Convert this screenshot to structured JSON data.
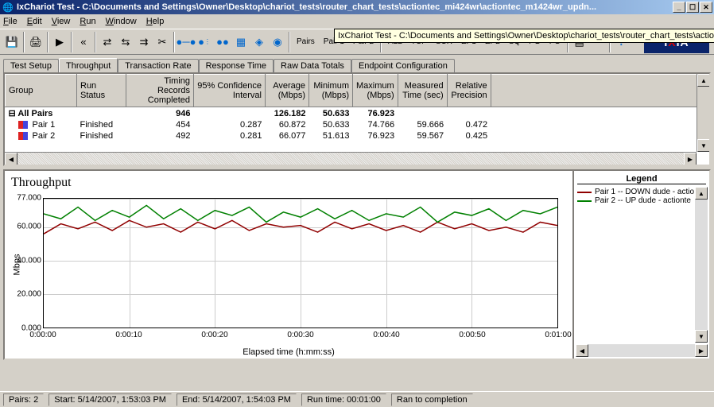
{
  "window": {
    "title": "IxChariot Test - C:\\Documents and Settings\\Owner\\Desktop\\chariot_tests\\router_chart_tests\\actiontec_mi424wr\\actiontec_m1424wr_updn..."
  },
  "tooltip": "IxChariot Test - C:\\Documents and Settings\\Owner\\Desktop\\chariot_tests\\router_chart_tests\\actio",
  "menu": {
    "file": "File",
    "edit": "Edit",
    "view": "View",
    "run": "Run",
    "window": "Window",
    "help": "Help"
  },
  "toolbar_text_btns": {
    "pairs": "Pairs",
    "pair1": "Pair 1",
    "pair2": "Pair 2",
    "all": "ALL",
    "tcp": "TCP",
    "scr": "SCR",
    "ep1": "EP1",
    "ep2": "EP2",
    "sq": "SQ",
    "pg": "PG",
    "pc": "PC"
  },
  "logo": {
    "i": "I",
    "x": "X",
    "ia": "IA"
  },
  "tabs": {
    "test_setup": "Test Setup",
    "throughput": "Throughput",
    "transaction_rate": "Transaction Rate",
    "response_time": "Response Time",
    "raw_data_totals": "Raw Data Totals",
    "endpoint_config": "Endpoint Configuration"
  },
  "grid": {
    "headers": {
      "group": "Group",
      "run_status": "Run Status",
      "timing": "Timing Records Completed",
      "conf": "95% Confidence Interval",
      "avg": "Average (Mbps)",
      "min": "Minimum (Mbps)",
      "max": "Maximum (Mbps)",
      "meas": "Measured Time (sec)",
      "prec": "Relative Precision"
    },
    "summary": {
      "group": "All Pairs",
      "timing": "946",
      "avg": "126.182",
      "min": "50.633",
      "max": "76.923"
    },
    "rows": [
      {
        "group": "Pair 1",
        "status": "Finished",
        "timing": "454",
        "conf": "0.287",
        "avg": "60.872",
        "min": "50.633",
        "max": "74.766",
        "meas": "59.666",
        "prec": "0.472"
      },
      {
        "group": "Pair 2",
        "status": "Finished",
        "timing": "492",
        "conf": "0.281",
        "avg": "66.077",
        "min": "51.613",
        "max": "76.923",
        "meas": "59.567",
        "prec": "0.425"
      }
    ]
  },
  "chart_data": {
    "type": "line",
    "title": "Throughput",
    "ylabel": "Mbps",
    "xlabel": "Elapsed time (h:mm:ss)",
    "ylim": [
      0,
      77
    ],
    "yticks": [
      "0.000",
      "20.000",
      "40.000",
      "60.000",
      "77.000"
    ],
    "ytick_vals": [
      0,
      20,
      40,
      60,
      77
    ],
    "xticks": [
      "0:00:00",
      "0:00:10",
      "0:00:20",
      "0:00:30",
      "0:00:40",
      "0:00:50",
      "0:01:00"
    ],
    "xtick_vals": [
      0,
      10,
      20,
      30,
      40,
      50,
      60
    ],
    "xlim": [
      0,
      60
    ],
    "series": [
      {
        "name": "Pair 1 -- DOWN dude - actio",
        "color": "#900000",
        "x": [
          0,
          2,
          4,
          6,
          8,
          10,
          12,
          14,
          16,
          18,
          20,
          22,
          24,
          26,
          28,
          30,
          32,
          34,
          36,
          38,
          40,
          42,
          44,
          46,
          48,
          50,
          52,
          54,
          56,
          58,
          60
        ],
        "y": [
          56,
          62,
          59,
          63,
          58,
          64,
          60,
          62,
          57,
          63,
          59,
          64,
          58,
          62,
          60,
          61,
          57,
          63,
          59,
          62,
          58,
          61,
          57,
          63,
          59,
          62,
          58,
          60,
          57,
          63,
          61
        ]
      },
      {
        "name": "Pair 2 -- UP dude - actionte",
        "color": "#008000",
        "x": [
          0,
          2,
          4,
          6,
          8,
          10,
          12,
          14,
          16,
          18,
          20,
          22,
          24,
          26,
          28,
          30,
          32,
          34,
          36,
          38,
          40,
          42,
          44,
          46,
          48,
          50,
          52,
          54,
          56,
          58,
          60
        ],
        "y": [
          68,
          65,
          72,
          64,
          70,
          66,
          73,
          65,
          71,
          64,
          70,
          67,
          72,
          63,
          69,
          66,
          71,
          65,
          70,
          64,
          68,
          66,
          72,
          63,
          69,
          67,
          71,
          64,
          70,
          68,
          72
        ]
      }
    ]
  },
  "legend": {
    "title": "Legend"
  },
  "status": {
    "pairs": "Pairs: 2",
    "start": "Start: 5/14/2007, 1:53:03 PM",
    "end": "End: 5/14/2007, 1:54:03 PM",
    "runtime": "Run time: 00:01:00",
    "completion": "Ran to completion"
  }
}
